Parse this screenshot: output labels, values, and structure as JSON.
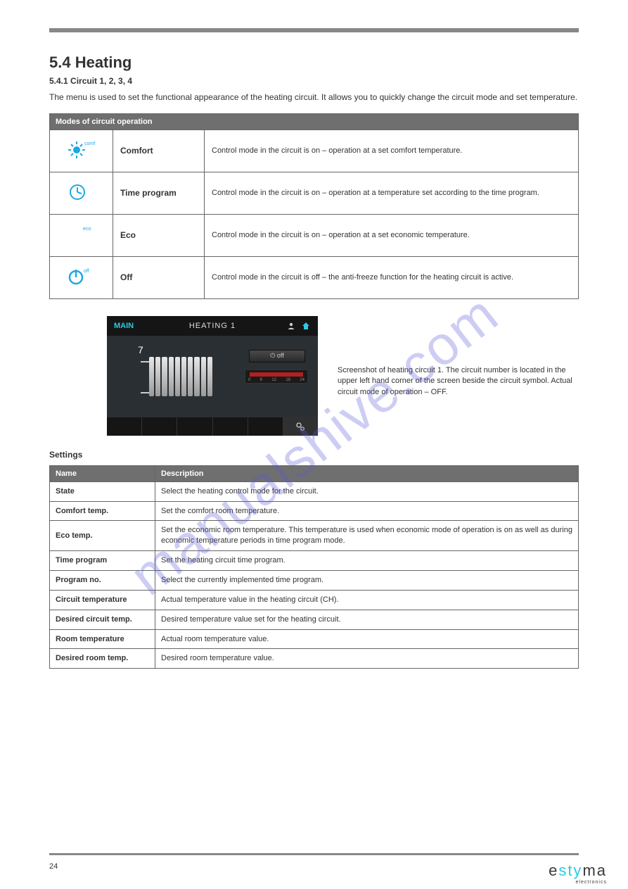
{
  "section": {
    "number": "5.4 Heating",
    "subtitle": "5.4.1 Circuit 1, 2, 3, 4",
    "intro": "The menu is used to set the functional appearance of the heating circuit. It allows you to quickly change the circuit mode and set temperature."
  },
  "modes_table": {
    "header": "Modes of circuit operation",
    "rows": [
      {
        "icon": "sun-icon",
        "label": "Comfort",
        "desc": "Control mode in the circuit is on – operation at a set comfort temperature."
      },
      {
        "icon": "clock-icon",
        "label": "Time program",
        "desc": "Control mode in the circuit is on – operation at a temperature set according to the time program."
      },
      {
        "icon": "moon-icon",
        "label": "Eco",
        "desc": "Control mode in the circuit is on – operation at a set economic temperature."
      },
      {
        "icon": "power-icon",
        "label": "Off",
        "desc": "Control mode in the circuit is off – the anti-freeze function for the heating circuit is active."
      }
    ]
  },
  "screenshot": {
    "main_label": "MAIN",
    "title": "HEATING 1",
    "number": "7",
    "mode_btn": "⏻ off",
    "ticks": [
      "0",
      "6",
      "12",
      "18",
      "24"
    ],
    "caption": "Screenshot of heating circuit 1. The circuit number is located in the upper left hand corner of the screen beside the circuit symbol. Actual circuit mode of operation – OFF."
  },
  "settings_table": {
    "title": "Settings",
    "header_name": "Name",
    "header_desc": "Description",
    "rows": [
      {
        "name": "State",
        "desc": "Select the heating control mode for the circuit."
      },
      {
        "name": "Comfort temp.",
        "desc": "Set the comfort room temperature."
      },
      {
        "name": "Eco temp.",
        "desc": "Set the economic room temperature. This temperature is used when economic mode of operation is on as well as during economic temperature periods in time program mode."
      },
      {
        "name": "Time program",
        "desc": "Set the heating circuit time program."
      },
      {
        "name": "Program no.",
        "desc": "Select the currently implemented time program."
      },
      {
        "name": "Circuit temperature",
        "desc": "Actual temperature value in the heating circuit (CH)."
      },
      {
        "name": "Desired circuit temp.",
        "desc": "Desired temperature value set for the heating circuit."
      },
      {
        "name": "Room temperature",
        "desc": "Actual room temperature value."
      },
      {
        "name": "Desired room temp.",
        "desc": "Desired room temperature value."
      }
    ]
  },
  "footer": {
    "page": "24",
    "brand_pre": "e",
    "brand_mid": "sty",
    "brand_post": "ma",
    "brand_sub": "electronics"
  },
  "watermark": "manualshive.com"
}
